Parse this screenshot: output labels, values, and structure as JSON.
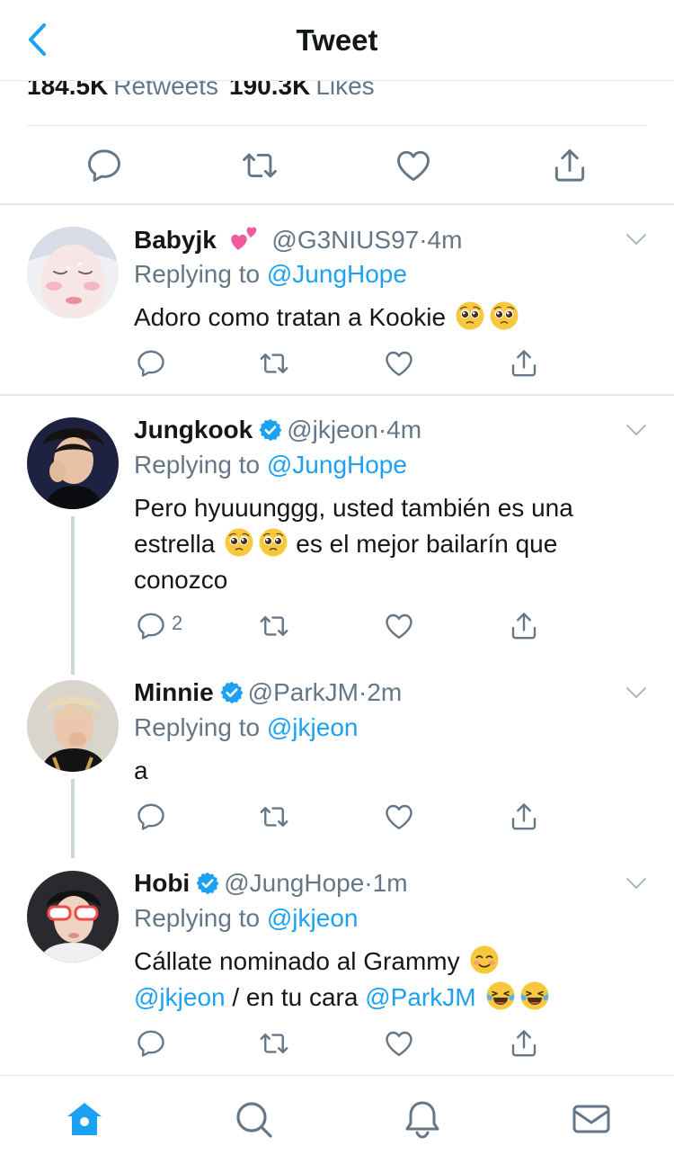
{
  "header": {
    "title": "Tweet"
  },
  "stats": {
    "retweets_count": "184.5K",
    "retweets_label": "Retweets",
    "likes_count": "190.3K",
    "likes_label": "Likes"
  },
  "replying_label": "Replying to",
  "colors": {
    "accent": "#1da1f2",
    "secondary_text": "#657786",
    "divider": "#e1e8ed",
    "thread_line": "#ccd6dd"
  },
  "tweets": [
    {
      "name": "Babyjk",
      "name_emoji": "two-hearts",
      "verified": false,
      "handle": "@G3NIUS97",
      "dot": "·",
      "time": "4m",
      "replying_to": "@JungHope",
      "text": "Adoro como tratan a Kookie",
      "emojis": [
        "pleading-face",
        "pleading-face"
      ]
    },
    {
      "name": "Jungkook",
      "verified": true,
      "handle": "@jkjeon",
      "dot": "·",
      "time": "4m",
      "replying_to": "@JungHope",
      "text_1": "Pero hyuuunggg, usted también es una estrella",
      "text_2": "es el mejor bailarín que conozco",
      "emojis": [
        "pleading-face",
        "pleading-face"
      ],
      "reply_count": "2"
    },
    {
      "name": "Minnie",
      "verified": true,
      "handle": "@ParkJM",
      "dot": "·",
      "time": "2m",
      "replying_to": "@jkjeon",
      "text": "a"
    },
    {
      "name": "Hobi",
      "verified": true,
      "handle": "@JungHope",
      "dot": "·",
      "time": "1m",
      "replying_to": "@jkjeon",
      "text_1": "Cállate nominado al Grammy",
      "mention_1": "@jkjeon",
      "text_2": " / en tu cara ",
      "mention_2": "@ParkJM",
      "emojis": [
        "smiling-face",
        "tears-of-joy",
        "tears-of-joy"
      ]
    }
  ],
  "bottom_nav": [
    "home",
    "search",
    "notifications",
    "messages"
  ]
}
